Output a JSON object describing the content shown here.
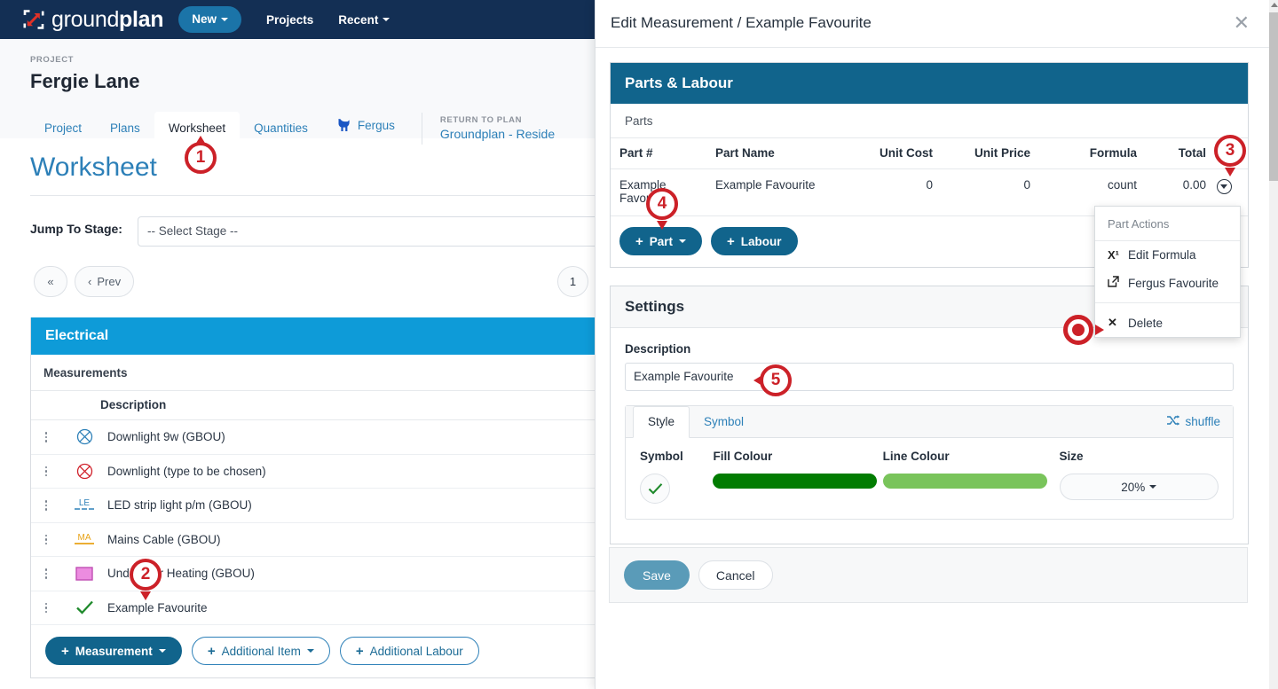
{
  "navbar": {
    "brand_ground": "ground",
    "brand_plan": "plan",
    "new_label": "New",
    "projects_label": "Projects",
    "recent_label": "Recent"
  },
  "project": {
    "kicker": "PROJECT",
    "name": "Fergie Lane",
    "tabs": [
      {
        "label": "Project",
        "active": false
      },
      {
        "label": "Plans",
        "active": false
      },
      {
        "label": "Worksheet",
        "active": true
      },
      {
        "label": "Quantities",
        "active": false
      },
      {
        "label": "Fergus",
        "active": false
      }
    ],
    "return_kicker": "RETURN TO PLAN",
    "return_plan": "Groundplan - Reside"
  },
  "worksheet": {
    "title": "Worksheet",
    "jump_label": "Jump To Stage:",
    "jump_value": "-- Select Stage --",
    "pager": {
      "first": "«",
      "prev": "Prev",
      "page": "1"
    },
    "stage_name": "Electrical",
    "measurements_label": "Measurements",
    "column_header": "Description",
    "rows": [
      {
        "name": "Downlight 9w (GBOU)",
        "symbol": "circle-cross-blue"
      },
      {
        "name": "Downlight (type to be chosen)",
        "symbol": "circle-cross-red"
      },
      {
        "name": "LED strip light p/m (GBOU)",
        "symbol": "le-dashed-blue"
      },
      {
        "name": "Mains Cable (GBOU)",
        "symbol": "ma-solid-orange"
      },
      {
        "name": "Underfloor Heating (GBOU)",
        "symbol": "square-pink"
      },
      {
        "name": "Example Favourite",
        "symbol": "check-green"
      }
    ],
    "buttons": {
      "measurement": "Measurement",
      "additional_item": "Additional Item",
      "additional_labour": "Additional Labour"
    }
  },
  "modal": {
    "title": "Edit Measurement / Example Favourite",
    "close_icon": "✕",
    "parts_labour": {
      "heading": "Parts & Labour",
      "parts_label": "Parts",
      "columns": [
        "Part #",
        "Part Name",
        "Unit Cost",
        "Unit Price",
        "Formula",
        "Total"
      ],
      "rows": [
        {
          "part_no": "Example Favourite",
          "part_name": "Example Favourite",
          "unit_cost": "0",
          "unit_price": "0",
          "formula": "count",
          "total": "0.00"
        }
      ],
      "add_part": "Part",
      "add_labour": "Labour"
    },
    "part_actions": {
      "title": "Part Actions",
      "items": [
        {
          "label": "Edit Formula",
          "icon": "X¹"
        },
        {
          "label": "Fergus Favourite",
          "icon": "external-link"
        },
        {
          "label": "Delete",
          "icon": "✕"
        }
      ]
    },
    "settings": {
      "heading": "Settings",
      "description_label": "Description",
      "description_value": "Example Favourite",
      "tabs": [
        {
          "label": "Style",
          "active": true
        },
        {
          "label": "Symbol",
          "active": false
        }
      ],
      "shuffle_label": "shuffle",
      "style": {
        "symbol_label": "Symbol",
        "fill_label": "Fill Colour",
        "line_label": "Line Colour",
        "size_label": "Size",
        "fill_colour": "#017c01",
        "line_colour": "#79c45b",
        "size_value": "20%",
        "symbol_glyph": "check-green"
      }
    },
    "footer": {
      "save": "Save",
      "cancel": "Cancel"
    }
  },
  "annotations": [
    {
      "number": "1"
    },
    {
      "number": "2"
    },
    {
      "number": "3"
    },
    {
      "number": "4"
    },
    {
      "number": "5"
    }
  ],
  "colors": {
    "navy": "#132f54",
    "brand_blue": "#2d80b8",
    "stage_blue": "#0e9bd8",
    "panel_blue": "#11648c",
    "annotation_red": "#cc2128"
  }
}
